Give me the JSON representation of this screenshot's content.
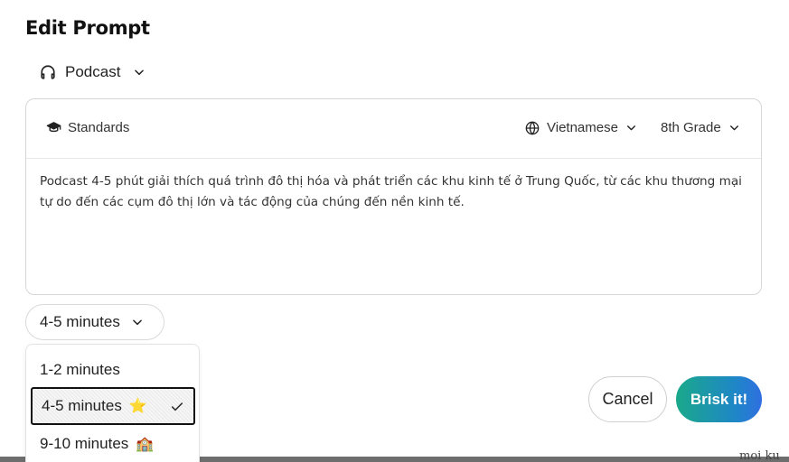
{
  "title": "Edit Prompt",
  "type_select": {
    "label": "Podcast",
    "icon": "headphones-icon"
  },
  "card": {
    "standards_label": "Standards",
    "language_label": "Vietnamese",
    "grade_label": "8th Grade",
    "prompt_text": "Podcast 4-5 phút giải thích quá trình đô thị hóa và phát triển các khu kinh tế ở Trung Quốc, từ các khu thương mại tự do đến các cụm đô thị lớn và tác động của chúng đến nền kinh tế."
  },
  "duration": {
    "selected_label": "4-5 minutes",
    "options": [
      {
        "label": "1-2 minutes",
        "emoji": "",
        "selected": false
      },
      {
        "label": "4-5 minutes",
        "emoji": "⭐",
        "selected": true
      },
      {
        "label": "9-10 minutes",
        "emoji": "🏫",
        "selected": false
      }
    ]
  },
  "actions": {
    "cancel_label": "Cancel",
    "submit_label": "Brisk it!"
  },
  "background_text": "moi ku",
  "colors": {
    "accent_start": "#1aa98a",
    "accent_end": "#2f6fe0",
    "border": "#d6d6d6"
  }
}
